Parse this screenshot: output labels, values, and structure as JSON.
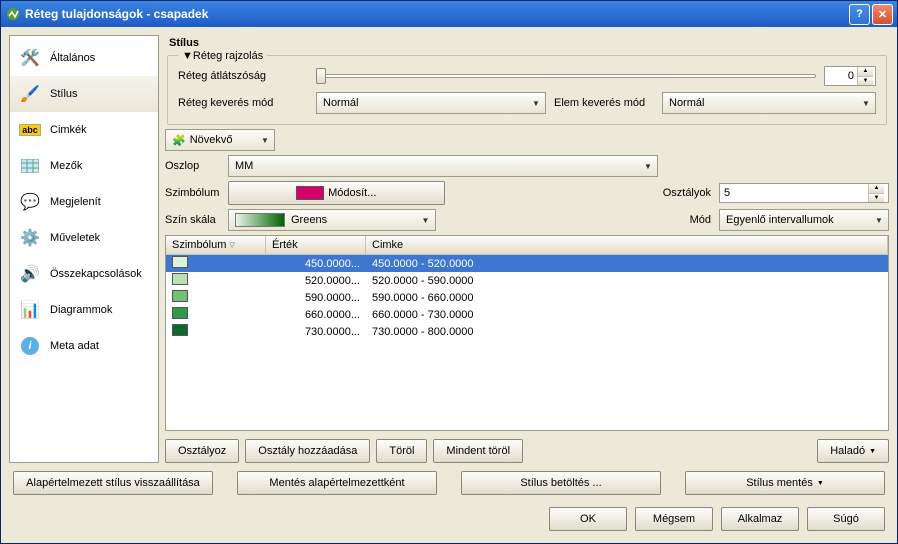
{
  "window": {
    "title": "Réteg tulajdonságok - csapadek"
  },
  "sidebar": {
    "items": [
      {
        "label": "Általános"
      },
      {
        "label": "Stílus"
      },
      {
        "label": "Cimkék"
      },
      {
        "label": "Mezők"
      },
      {
        "label": "Megjelenít"
      },
      {
        "label": "Műveletek"
      },
      {
        "label": "Összekapcsolások"
      },
      {
        "label": "Diagrammok"
      },
      {
        "label": "Meta adat"
      }
    ]
  },
  "panel": {
    "title": "Stílus",
    "render_group": "Réteg rajzolás",
    "opacity_label": "Réteg átlátszóság",
    "opacity_value": "0",
    "blend_label": "Réteg keverés mód",
    "blend_value": "Normál",
    "feature_blend_label": "Elem keverés mód",
    "feature_blend_value": "Normál",
    "renderer_mode": "Növekvő",
    "column_label": "Oszlop",
    "column_value": "MM",
    "symbol_label": "Szimbólum",
    "symbol_btn": "Módosít...",
    "classes_label": "Osztályok",
    "classes_value": "5",
    "ramp_label": "Szín skála",
    "ramp_value": "Greens",
    "mode_label": "Mód",
    "mode_value": "Egyenlő intervallumok"
  },
  "table": {
    "headers": {
      "sym": "Szimbólum",
      "val": "Érték",
      "lbl": "Cimke"
    },
    "rows": [
      {
        "color": "#dff2df",
        "value": "450.0000...",
        "label": "450.0000 - 520.0000",
        "selected": true
      },
      {
        "color": "#b6e2b4",
        "value": "520.0000...",
        "label": "520.0000 - 590.0000"
      },
      {
        "color": "#72c173",
        "value": "590.0000...",
        "label": "590.0000 - 660.0000"
      },
      {
        "color": "#2f9b4a",
        "value": "660.0000...",
        "label": "660.0000 - 730.0000"
      },
      {
        "color": "#0a6b2d",
        "value": "730.0000...",
        "label": "730.0000 - 800.0000"
      }
    ]
  },
  "buttons": {
    "classify": "Osztályoz",
    "add_class": "Osztály hozzáadása",
    "delete": "Töröl",
    "delete_all": "Mindent töröl",
    "advanced": "Haladó",
    "restore_default": "Alapértelmezett stílus visszaállítása",
    "save_default": "Mentés alapértelmezettként",
    "load_style": "Stílus betöltés ...",
    "save_style": "Stílus mentés",
    "ok": "OK",
    "cancel": "Mégsem",
    "apply": "Alkalmaz",
    "help": "Súgó"
  }
}
